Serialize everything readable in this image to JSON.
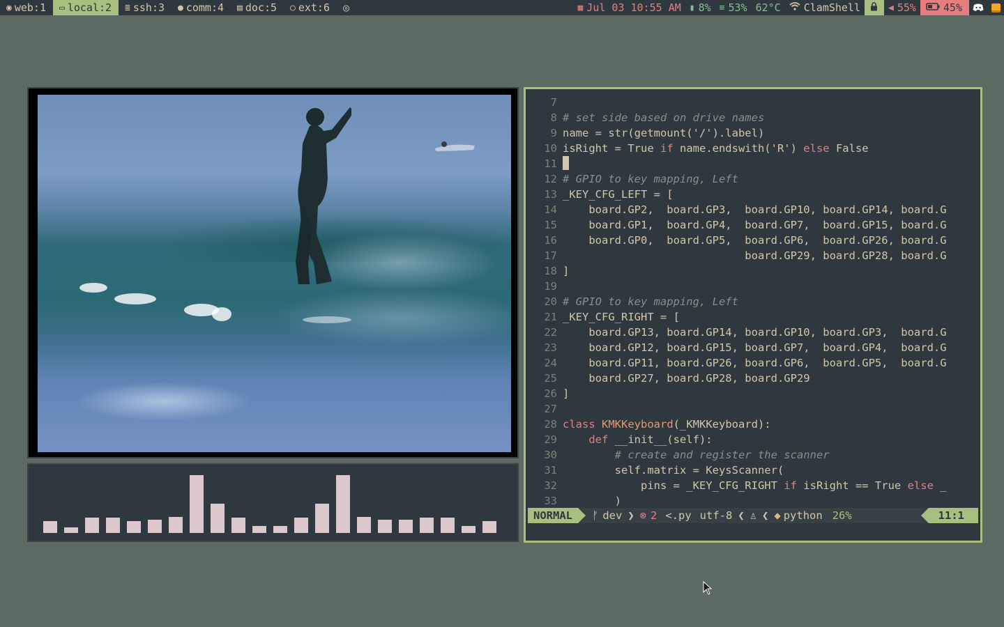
{
  "bar": {
    "workspaces": [
      {
        "icon": "chrome-icon",
        "label": "web:1",
        "active": false
      },
      {
        "icon": "monitor-icon",
        "label": "local:2",
        "active": true
      },
      {
        "icon": "server-icon",
        "label": "ssh:3",
        "active": false
      },
      {
        "icon": "chat-icon",
        "label": "comm:4",
        "active": false
      },
      {
        "icon": "document-icon",
        "label": "doc:5",
        "active": false
      },
      {
        "icon": "extension-icon",
        "label": "ext:6",
        "active": false
      }
    ],
    "datetime": "Jul 03 10:55 AM",
    "cpu": "8%",
    "memory": "53%",
    "temperature": "62°C",
    "network": "ClamShell",
    "volume": "55%",
    "battery": "45%",
    "colors": {
      "accent": "#a7c080",
      "bar_bg": "#2f383e",
      "alert": "#e67e80"
    }
  },
  "visualizer": {
    "levels": [
      0.2,
      0.1,
      0.26,
      0.26,
      0.2,
      0.23,
      0.28,
      1.0,
      0.5,
      0.26,
      0.12,
      0.12,
      0.26,
      0.5,
      1.0,
      0.28,
      0.23,
      0.23,
      0.26,
      0.26,
      0.12,
      0.2
    ]
  },
  "editor": {
    "lines": [
      {
        "n": "7",
        "html": ""
      },
      {
        "n": "8",
        "html": "<span class='cm'># set side based on drive names</span>"
      },
      {
        "n": "9",
        "html": "name = str(getmount('/').label)"
      },
      {
        "n": "10",
        "html": "isRight = True <span class='kw'>if</span> name.endswith('R') <span class='kw'>else</span> False"
      },
      {
        "n": "11",
        "html": "<span class='cursor'></span>"
      },
      {
        "n": "12",
        "html": "<span class='cm'># GPIO to key mapping, Left</span>"
      },
      {
        "n": "13",
        "html": "_KEY_CFG_LEFT = ["
      },
      {
        "n": "14",
        "html": "    board.GP2,  board.GP3,  board.GP10, board.GP14, board.G"
      },
      {
        "n": "15",
        "html": "    board.GP1,  board.GP4,  board.GP7,  board.GP15, board.G"
      },
      {
        "n": "16",
        "html": "    board.GP0,  board.GP5,  board.GP6,  board.GP26, board.G"
      },
      {
        "n": "17",
        "html": "                            board.GP29, board.GP28, board.G"
      },
      {
        "n": "18",
        "html": "]"
      },
      {
        "n": "19",
        "html": ""
      },
      {
        "n": "20",
        "html": "<span class='cm'># GPIO to key mapping, Left</span>"
      },
      {
        "n": "21",
        "html": "_KEY_CFG_RIGHT = ["
      },
      {
        "n": "22",
        "html": "    board.GP13, board.GP14, board.GP10, board.GP3,  board.G"
      },
      {
        "n": "23",
        "html": "    board.GP12, board.GP15, board.GP7,  board.GP4,  board.G"
      },
      {
        "n": "24",
        "html": "    board.GP11, board.GP26, board.GP6,  board.GP5,  board.G"
      },
      {
        "n": "25",
        "html": "    board.GP27, board.GP28, board.GP29"
      },
      {
        "n": "26",
        "html": "]"
      },
      {
        "n": "27",
        "html": ""
      },
      {
        "n": "28",
        "html": "<span class='kw'>class</span> <span class='cls'>KMKKeyboard</span>(_KMKKeyboard):"
      },
      {
        "n": "29",
        "html": "    <span class='kw'>def</span> __init__(self):"
      },
      {
        "n": "30",
        "html": "        <span class='cm'># create and register the scanner</span>"
      },
      {
        "n": "31",
        "html": "        self.matrix = KeysScanner("
      },
      {
        "n": "32",
        "html": "            pins = _KEY_CFG_RIGHT <span class='kw'>if</span> isRight == True <span class='kw'>else</span> _"
      },
      {
        "n": "33",
        "html": "        )"
      }
    ],
    "status": {
      "mode": "NORMAL",
      "branch": "dev",
      "errors": "2",
      "file": "<.py",
      "encoding": "utf-8",
      "filetype": "python",
      "percent": "26%",
      "position": "11:1"
    }
  }
}
